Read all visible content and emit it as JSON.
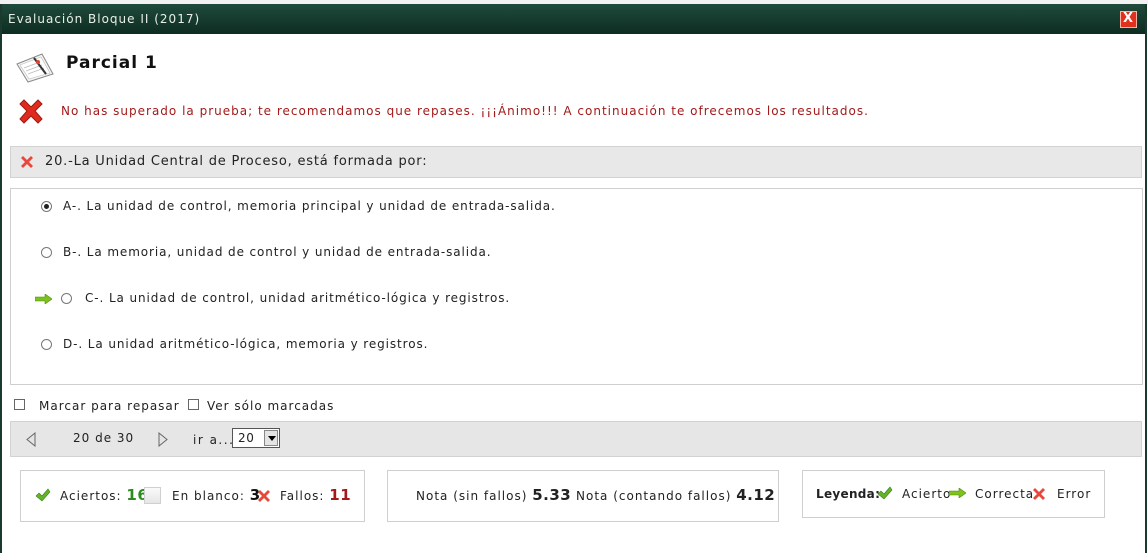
{
  "window": {
    "title": "Evaluación Bloque II (2017)",
    "close_label": "X"
  },
  "header": {
    "title": "Parcial 1"
  },
  "result": {
    "message": "No has superado la prueba; te recomendamos que repases. ¡¡¡Ánimo!!! A continuación te ofrecemos los resultados."
  },
  "question": {
    "text": "20.-La Unidad Central de Proceso, está formada por:"
  },
  "options": [
    {
      "label": "A-. La unidad de control, memoria principal y unidad de entrada-salida.",
      "selected": true,
      "correct": false
    },
    {
      "label": "B-. La memoria, unidad de control y unidad de entrada-salida.",
      "selected": false,
      "correct": false
    },
    {
      "label": "C-. La unidad de control, unidad aritmético-lógica y registros.",
      "selected": false,
      "correct": true
    },
    {
      "label": "D-. La unidad aritmético-lógica, memoria y registros.",
      "selected": false,
      "correct": false
    }
  ],
  "review": {
    "mark_label": "Marcar para repasar",
    "only_marked_label": "Ver sólo marcadas"
  },
  "navigation": {
    "page_text": "20 de 30",
    "goto_label": "ir a...",
    "goto_value": "20"
  },
  "stats": {
    "hits_label": "Aciertos:",
    "hits": "16",
    "blank_label": "En blanco:",
    "blank": "3",
    "fails_label": "Fallos:",
    "fails": "11",
    "grade_no_fail_label": "Nota (sin fallos)",
    "grade_no_fail": "5.33",
    "grade_fail_label": "Nota (contando fallos)",
    "grade_fail": "4.12"
  },
  "legend": {
    "title": "Leyenda:",
    "hit": "Acierto",
    "correct": "Correcta",
    "error": "Error"
  },
  "colors": {
    "titlebar": "#1a3d30",
    "error_text": "#a31a1a",
    "hits": "#2e8b1e",
    "fails": "#a31a1a"
  }
}
